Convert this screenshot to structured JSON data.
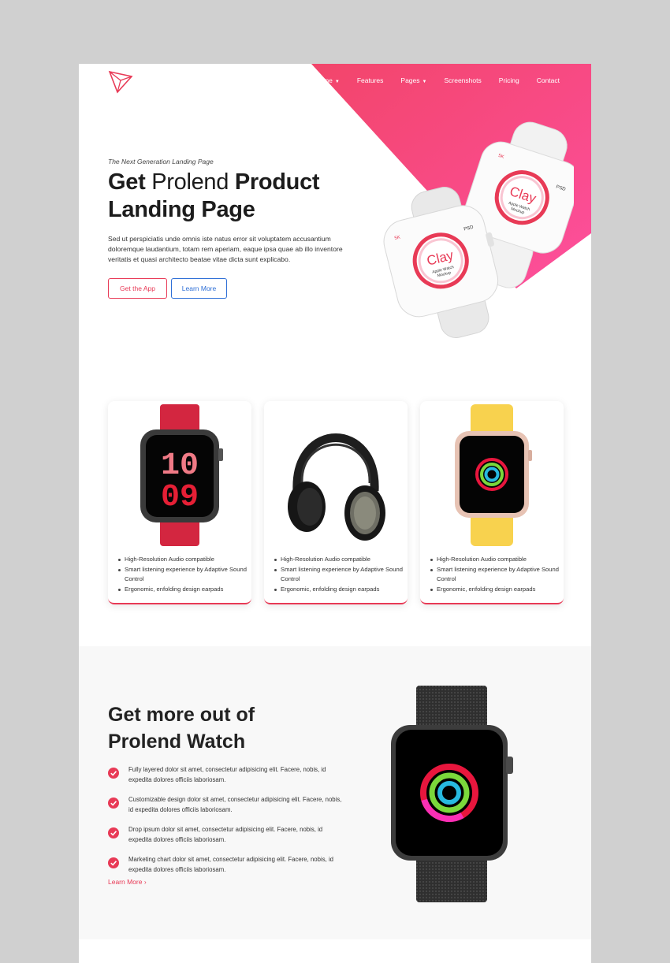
{
  "nav": {
    "items": [
      {
        "label": "Home",
        "has_dropdown": true
      },
      {
        "label": "Features",
        "has_dropdown": false
      },
      {
        "label": "Pages",
        "has_dropdown": true
      },
      {
        "label": "Screenshots",
        "has_dropdown": false
      },
      {
        "label": "Pricing",
        "has_dropdown": false
      },
      {
        "label": "Contact",
        "has_dropdown": false
      }
    ]
  },
  "hero": {
    "tagline": "The Next Generation Landing Page",
    "title_parts": [
      "Get",
      " Prolend ",
      "Product",
      "Landing Page"
    ],
    "lead": "Sed ut perspiciatis unde omnis iste natus error sit voluptatem accusantium doloremque laudantium, totam rem aperiam, eaque ipsa quae ab illo inventore veritatis et quasi architecto beatae vitae dicta sunt explicabo.",
    "primary_button": "Get the App",
    "secondary_button": "Learn More",
    "mockup": {
      "brand": "Clay",
      "sub1": "Apple Watch",
      "sub2": "Mockup",
      "badge_left": "5K",
      "badge_right": "PSD"
    }
  },
  "cards": [
    {
      "product": "red-watch",
      "time_top": "10",
      "time_bottom": "09",
      "features": [
        "High-Resolution Audio compatible",
        "Smart listening experience by Adaptive Sound Control",
        "Ergonomic, enfolding design earpads"
      ]
    },
    {
      "product": "headphones",
      "features": [
        "High-Resolution Audio compatible",
        "Smart listening experience by Adaptive Sound Control",
        "Ergonomic, enfolding design earpads"
      ]
    },
    {
      "product": "yellow-watch",
      "features": [
        "High-Resolution Audio compatible",
        "Smart listening experience by Adaptive Sound Control",
        "Ergonomic, enfolding design earpads"
      ]
    }
  ],
  "features": {
    "title_line1": "Get more out of",
    "title_line2": "Prolend Watch",
    "items": [
      "Fully layered dolor sit amet, consectetur adipisicing elit. Facere, nobis, id expedita dolores officiis laboriosam.",
      "Customizable design dolor sit amet, consectetur adipisicing elit. Facere, nobis, id expedita dolores officiis laboriosam.",
      "Drop ipsum dolor sit amet, consectetur adipisicing elit. Facere, nobis, id expedita dolores officiis laboriosam.",
      "Marketing chart dolor sit amet, consectetur adipisicing elit. Facere, nobis, id expedita dolores officiis laboriosam."
    ],
    "learn_more": "Learn More",
    "learn_more_icon": "chevron-right-icon"
  },
  "colors": {
    "accent": "#e83a56",
    "gradient_start": "#f2456a",
    "gradient_end": "#fd4f9d",
    "blue": "#2e6fd6",
    "check": "#e83a56"
  }
}
